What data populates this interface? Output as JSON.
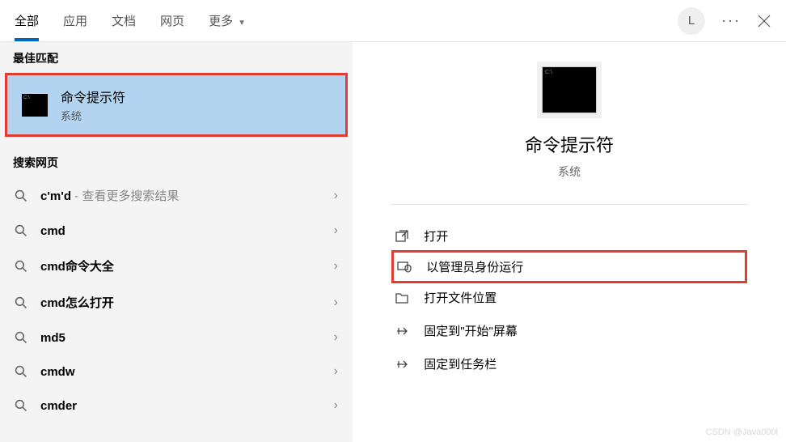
{
  "header": {
    "tabs": [
      "全部",
      "应用",
      "文档",
      "网页",
      "更多"
    ],
    "avatar": "L"
  },
  "left": {
    "best_match_header": "最佳匹配",
    "best_match": {
      "title": "命令提示符",
      "subtitle": "系统"
    },
    "search_web_header": "搜索网页",
    "items": [
      {
        "label": "c'm'd",
        "hint": " - 查看更多搜索结果"
      },
      {
        "label": "cmd",
        "hint": ""
      },
      {
        "label": "cmd命令大全",
        "hint": ""
      },
      {
        "label": "cmd怎么打开",
        "hint": ""
      },
      {
        "label": "md5",
        "hint": ""
      },
      {
        "label": "cmdw",
        "hint": ""
      },
      {
        "label": "cmder",
        "hint": ""
      }
    ]
  },
  "right": {
    "title": "命令提示符",
    "subtitle": "系统",
    "actions": [
      {
        "label": "打开",
        "icon": "open"
      },
      {
        "label": "以管理员身份运行",
        "icon": "admin",
        "highlighted": true
      },
      {
        "label": "打开文件位置",
        "icon": "folder"
      },
      {
        "label": "固定到\"开始\"屏幕",
        "icon": "pin"
      },
      {
        "label": "固定到任务栏",
        "icon": "pin"
      }
    ]
  },
  "watermark": "CSDN @Java000l"
}
